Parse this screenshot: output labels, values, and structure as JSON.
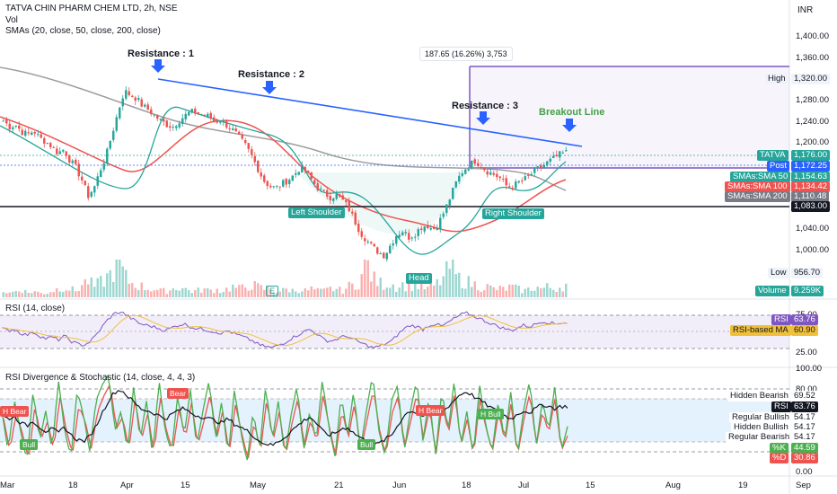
{
  "header": {
    "title": "TATVA CHIN PHARM CHEM LTD, 2h, NSE",
    "vol_label": "Vol",
    "sma_label": "SMAs (20, close, 50, close, 200, close)",
    "currency": "INR"
  },
  "panes": {
    "rsi_title": "RSI (14, close)",
    "div_title": "RSI Divergence & Stochastic (14, close, 4, 4, 3)"
  },
  "annotations": {
    "res1": "Resistance : 1",
    "res2": "Resistance : 2",
    "res3": "Resistance : 3",
    "breakout": "Breakout Line",
    "measure": "187.65 (16.26%) 3,753",
    "left_shoulder": "Left Shoulder",
    "head": "Head",
    "right_shoulder": "Right Shoulder",
    "earnings": "E"
  },
  "price_axis": {
    "ticks": [
      "1,400.00",
      "1,360.00",
      "1,320.00",
      "1,280.00",
      "1,240.00",
      "1,200.00",
      "1,000.00"
    ],
    "high_label": "High",
    "high_value": "1,320.00",
    "low_label": "Low",
    "low_value": "956.70",
    "volume_label": "Volume",
    "volume_value": "9.259K",
    "ticker_label": "TATVA",
    "ticker_value": "1,176.00",
    "post_label": "Post",
    "post_value": "1,172.25",
    "sma50_label": "SMAs:SMA 50",
    "sma50_value": "1,154.63",
    "sma100_label": "SMAs:SMA 100",
    "sma100_value": "1,134.42",
    "sma200_label": "SMAs:SMA 200",
    "sma200_value": "1,110.48",
    "support_value": "1,083.00",
    "hidden_1": "1,040.00"
  },
  "rsi_axis": {
    "ticks": [
      "75.00",
      "25.00"
    ],
    "rsi_label": "RSI",
    "rsi_value": "63.76",
    "ma_label": "RSI-based MA",
    "ma_value": "60.90"
  },
  "div_axis": {
    "ticks": [
      "100.00",
      "80.00",
      "0.00"
    ],
    "items": [
      {
        "label": "Hidden Bearish",
        "value": "69.52"
      },
      {
        "label": "RSI",
        "value": "63.76"
      },
      {
        "label": "Regular Bullish",
        "value": "54.17"
      },
      {
        "label": "Hidden Bullish",
        "value": "54.17"
      },
      {
        "label": "Regular Bearish",
        "value": "54.17"
      },
      {
        "label": "%K",
        "value": "44.59"
      },
      {
        "label": "%D",
        "value": "30.86"
      }
    ],
    "markers": [
      "H Bear",
      "Bear",
      "Bull",
      "Bull",
      "H Bear",
      "H Bull"
    ]
  },
  "time_axis": [
    "Mar",
    "18",
    "Apr",
    "15",
    "May",
    "21",
    "Jun",
    "18",
    "Jul",
    "15",
    "Aug",
    "19",
    "Sep"
  ],
  "colors": {
    "up": "#26a69a",
    "down": "#ef5350",
    "trend": "#2962ff",
    "sma20": "#26a69a",
    "sma50": "#ef5350",
    "sma200": "#9e9e9e",
    "measure": "#7e57c2",
    "rsi": "#7e57c2",
    "rsi_ma": "#f0c03a"
  },
  "chart_data": {
    "type": "candlestick",
    "symbol": "TATVA",
    "exchange": "NSE",
    "interval": "2h",
    "ylim": [
      940,
      1420
    ],
    "x": [
      "Mar",
      "18",
      "Apr",
      "15",
      "May",
      "21",
      "Jun",
      "18",
      "Jul",
      "15",
      "Aug",
      "19",
      "Sep"
    ],
    "key_levels": {
      "support": 1083.0,
      "high": 1320.0,
      "low": 956.7,
      "last": 1176.0,
      "post": 1172.25,
      "sma50": 1154.63,
      "sma100": 1134.42,
      "sma200": 1110.48
    },
    "close_path": [
      1240,
      1228,
      1232,
      1218,
      1212,
      1220,
      1205,
      1198,
      1188,
      1175,
      1182,
      1160,
      1145,
      1120,
      1088,
      1105,
      1140,
      1170,
      1215,
      1260,
      1300,
      1292,
      1285,
      1270,
      1262,
      1250,
      1240,
      1232,
      1228,
      1240,
      1250,
      1258,
      1256,
      1252,
      1248,
      1238,
      1242,
      1230,
      1220,
      1205,
      1190,
      1170,
      1145,
      1120,
      1108,
      1104,
      1112,
      1120,
      1130,
      1145,
      1138,
      1120,
      1104,
      1094,
      1086,
      1090,
      1080,
      1065,
      1040,
      1015,
      1000,
      985,
      975,
      968,
      990,
      1010,
      1018,
      1005,
      1012,
      1025,
      1030,
      1020,
      1035,
      1060,
      1090,
      1120,
      1140,
      1150,
      1160,
      1148,
      1138,
      1132,
      1125,
      1110,
      1105,
      1115,
      1120,
      1130,
      1140,
      1148,
      1156,
      1164,
      1172,
      1176
    ],
    "volume_path": [
      3,
      2,
      3,
      4,
      2,
      3,
      2,
      2,
      3,
      4,
      5,
      4,
      3,
      6,
      8,
      5,
      7,
      9,
      12,
      18,
      10,
      7,
      6,
      5,
      4,
      4,
      3,
      3,
      4,
      5,
      4,
      3,
      3,
      4,
      3,
      4,
      3,
      4,
      5,
      4,
      5,
      6,
      5,
      4,
      4,
      3,
      3,
      4,
      3,
      4,
      3,
      4,
      3,
      3,
      4,
      4,
      3,
      5,
      6,
      8,
      18,
      9,
      7,
      6,
      7,
      5,
      6,
      5,
      6,
      5,
      4,
      5,
      7,
      10,
      16,
      9,
      8,
      7,
      6,
      5,
      5,
      4,
      4,
      4,
      5,
      4,
      3,
      4,
      5,
      4,
      5,
      4,
      5,
      6
    ],
    "rsi_path": [
      55,
      52,
      54,
      48,
      45,
      50,
      44,
      40,
      42,
      38,
      44,
      36,
      32,
      30,
      35,
      45,
      58,
      70,
      78,
      80,
      74,
      68,
      62,
      60,
      58,
      55,
      52,
      56,
      60,
      62,
      58,
      55,
      54,
      52,
      50,
      48,
      52,
      47,
      44,
      40,
      36,
      30,
      28,
      26,
      30,
      34,
      40,
      45,
      50,
      54,
      48,
      40,
      36,
      38,
      42,
      44,
      38,
      34,
      30,
      26,
      28,
      32,
      36,
      46,
      55,
      60,
      58,
      54,
      60,
      62,
      58,
      64,
      70,
      76,
      78,
      74,
      70,
      66,
      62,
      58,
      55,
      52,
      56,
      60,
      58,
      62,
      66,
      64,
      62,
      64,
      63.76
    ],
    "stoch_k_path": [
      60,
      20,
      70,
      40,
      10,
      80,
      30,
      60,
      20,
      90,
      40,
      15,
      80,
      55,
      20,
      70,
      85,
      95,
      40,
      60,
      20,
      85,
      30,
      70,
      15,
      90,
      40,
      20,
      75,
      35,
      80,
      25,
      60,
      90,
      30,
      70,
      15,
      80,
      40,
      10,
      60,
      20,
      85,
      30,
      70,
      15,
      55,
      85,
      20,
      60,
      30,
      90,
      45,
      15,
      75,
      35,
      80,
      20,
      60,
      95,
      40,
      15,
      70,
      85,
      20,
      60,
      90,
      30,
      75,
      15,
      80,
      40,
      90,
      25,
      60,
      15,
      85,
      45,
      20,
      70,
      30,
      80,
      15,
      60,
      90,
      25,
      70,
      40,
      85,
      20,
      44.59
    ],
    "stoch_d_path": [
      50,
      40,
      45,
      50,
      35,
      45,
      55,
      40,
      45,
      55,
      60,
      40,
      45,
      55,
      45,
      50,
      65,
      80,
      65,
      55,
      45,
      55,
      50,
      45,
      40,
      55,
      55,
      40,
      50,
      45,
      55,
      45,
      45,
      60,
      55,
      55,
      40,
      50,
      50,
      35,
      40,
      40,
      55,
      50,
      50,
      35,
      45,
      60,
      50,
      45,
      45,
      60,
      55,
      35,
      45,
      45,
      55,
      40,
      45,
      65,
      60,
      35,
      45,
      65,
      50,
      45,
      65,
      55,
      50,
      40,
      55,
      50,
      65,
      45,
      50,
      35,
      55,
      55,
      35,
      50,
      45,
      55,
      35,
      45,
      65,
      45,
      50,
      50,
      60,
      40,
      30.86
    ]
  }
}
